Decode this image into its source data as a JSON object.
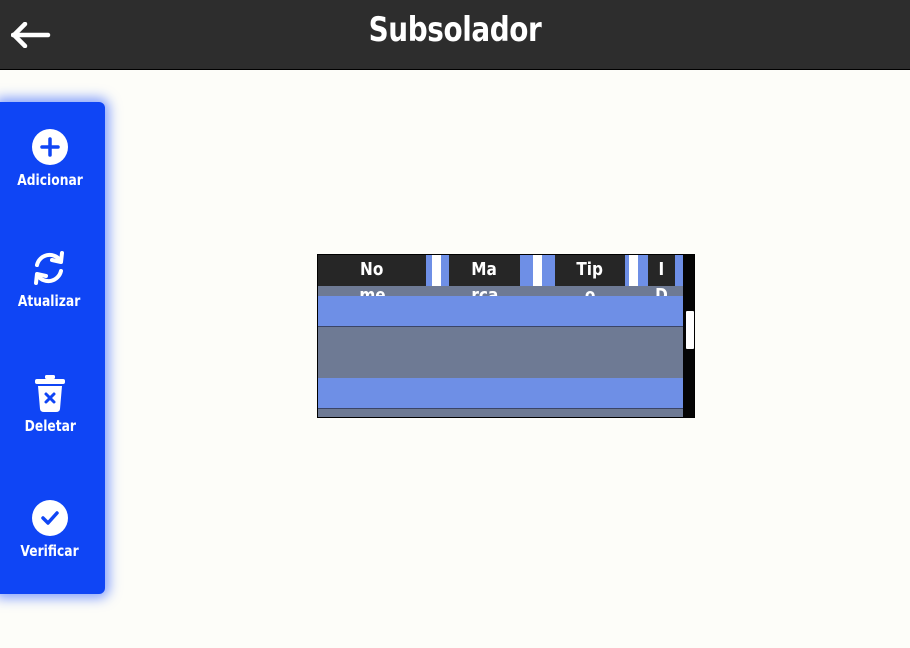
{
  "header": {
    "title": "Subsolador",
    "back_icon": "arrow-left-icon"
  },
  "sidebar": {
    "items": [
      {
        "label": "Adicionar",
        "icon": "plus-circle-icon"
      },
      {
        "label": "Atualizar",
        "icon": "refresh-icon"
      },
      {
        "label": "Deletar",
        "icon": "trash-icon"
      },
      {
        "label": "Verificar",
        "icon": "check-circle-icon"
      }
    ],
    "color": "#0f45f5"
  },
  "table": {
    "columns": [
      {
        "line1": "No",
        "line2": "me"
      },
      {
        "line1": "Ma",
        "line2": "rca"
      },
      {
        "line1": "Tip",
        "line2": "o"
      },
      {
        "line1": "I",
        "line2": "D"
      }
    ],
    "rows": [
      [
        "",
        "",
        "",
        ""
      ],
      [
        "",
        "",
        "",
        ""
      ],
      [
        "",
        "",
        "",
        ""
      ]
    ],
    "row_color": "#6e8fe6",
    "alt_color": "#6e7a94"
  }
}
